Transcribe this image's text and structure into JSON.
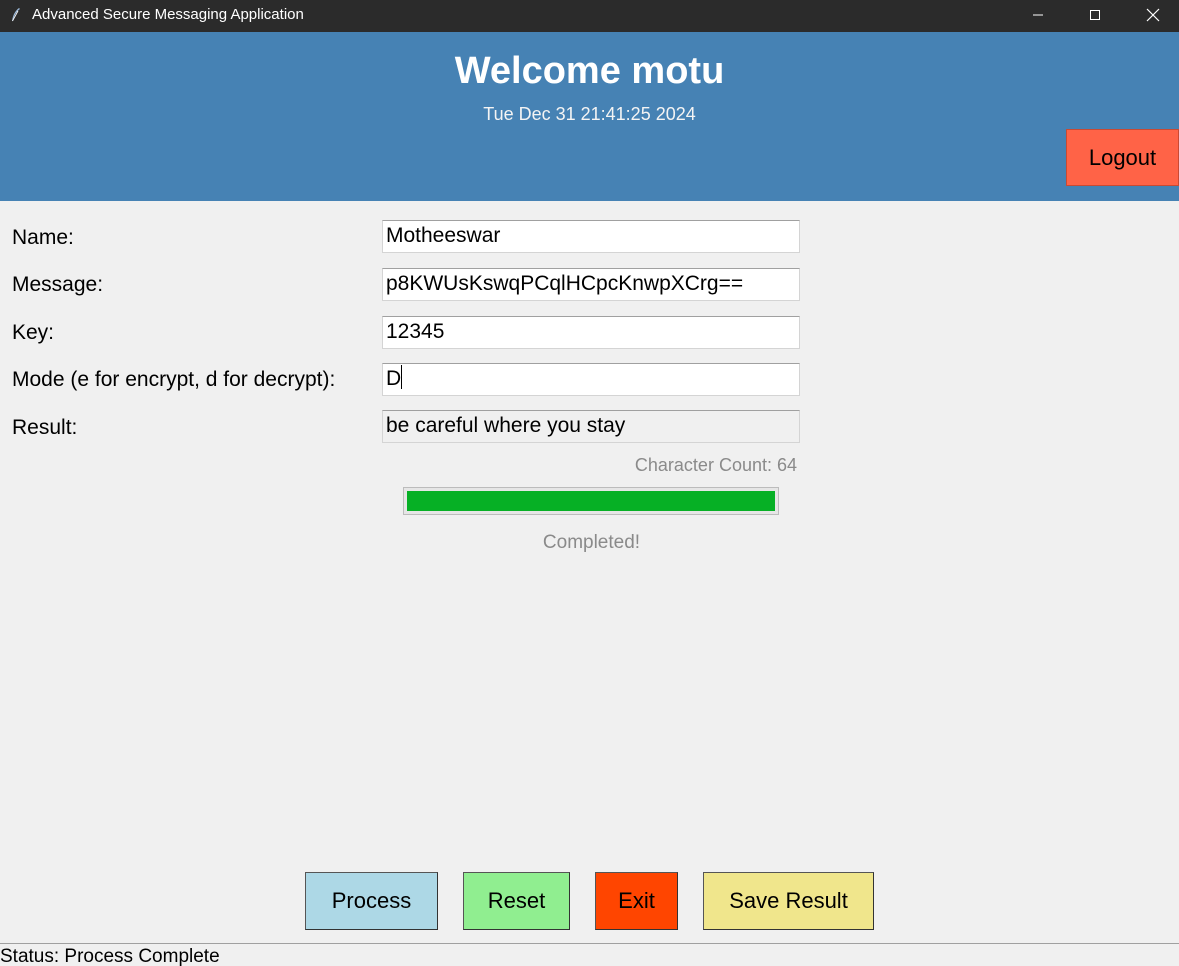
{
  "window": {
    "title": "Advanced Secure Messaging Application"
  },
  "header": {
    "welcome": "Welcome motu",
    "datetime": "Tue Dec 31 21:41:25 2024",
    "logout_label": "Logout"
  },
  "form": {
    "name_label": "Name:",
    "name_value": "Motheeswar",
    "message_label": "Message:",
    "message_value": "p8KWUsKswqPCqlHCpcKnwpXCrg==",
    "key_label": "Key:",
    "key_value": "12345",
    "mode_label": "Mode (e for encrypt, d for decrypt):",
    "mode_value": "D",
    "result_label": "Result:",
    "result_value": "be careful where you stay"
  },
  "info": {
    "char_count": "Character Count: 64",
    "progress_percent": 100,
    "progress_text": "Completed!"
  },
  "buttons": {
    "process": "Process",
    "reset": "Reset",
    "exit": "Exit",
    "save": "Save Result"
  },
  "status": {
    "text": "Status: Process Complete"
  },
  "colors": {
    "header_bg": "#4682b4",
    "logout_bg": "#ff6347",
    "progress_fill": "#06b025",
    "process_bg": "#add8e6",
    "reset_bg": "#90ee90",
    "exit_bg": "#ff4500",
    "save_bg": "#f0e68c"
  },
  "icons": {
    "app": "feather-icon",
    "minimize": "minimize-icon",
    "maximize": "maximize-icon",
    "close": "close-icon"
  }
}
